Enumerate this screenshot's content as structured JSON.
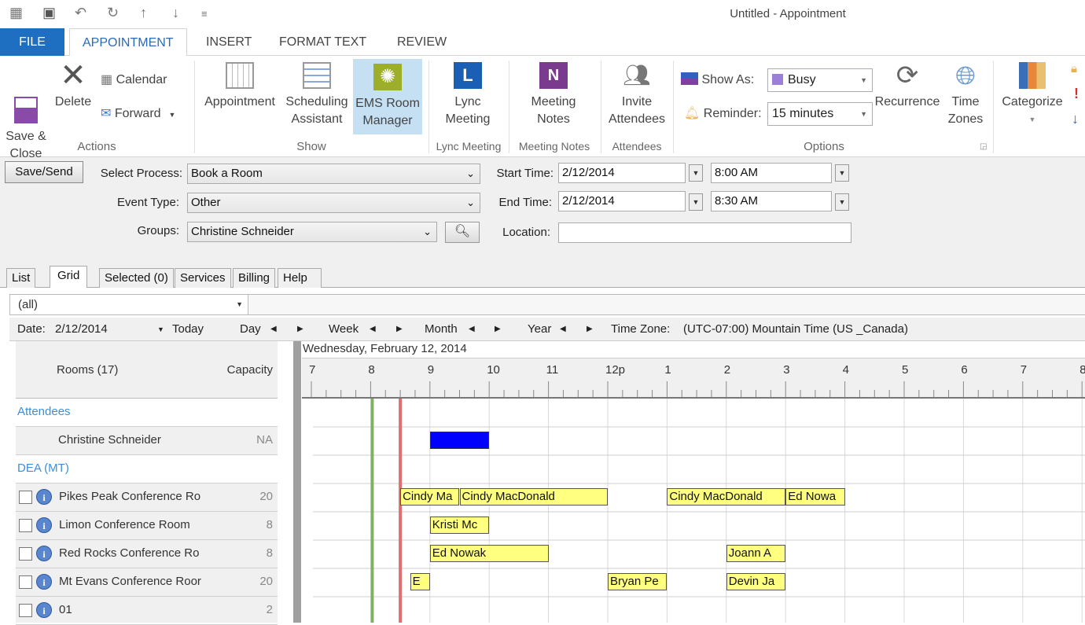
{
  "window": {
    "title": "Untitled - Appointment"
  },
  "ribbon_tabs": [
    "FILE",
    "APPOINTMENT",
    "INSERT",
    "FORMAT TEXT",
    "REVIEW"
  ],
  "ribbon": {
    "actions": {
      "save_close": "Save &\nClose",
      "delete": "Delete",
      "calendar": "Calendar",
      "forward": "Forward",
      "group": "Actions"
    },
    "show": {
      "appointment": "Appointment",
      "scheduling": "Scheduling\nAssistant",
      "ems": "EMS Room\nManager",
      "group": "Show"
    },
    "lync": {
      "label": "Lync\nMeeting",
      "group": "Lync Meeting"
    },
    "notes": {
      "label": "Meeting\nNotes",
      "group": "Meeting Notes"
    },
    "attendees": {
      "label": "Invite\nAttendees",
      "group": "Attendees"
    },
    "options": {
      "show_as_label": "Show As:",
      "show_as": "Busy",
      "reminder_label": "Reminder:",
      "reminder": "15 minutes",
      "recurrence": "Recurrence",
      "time_zones": "Time\nZones",
      "group": "Options"
    },
    "tags": {
      "categorize": "Categorize"
    }
  },
  "form": {
    "save_send": "Save/Send",
    "select_process_label": "Select Process:",
    "select_process": "Book a Room",
    "event_type_label": "Event Type:",
    "event_type": "Other",
    "groups_label": "Groups:",
    "groups": "Christine Schneider",
    "start_label": "Start Time:",
    "start_date": "2/12/2014",
    "start_time": "8:00 AM",
    "end_label": "End Time:",
    "end_date": "2/12/2014",
    "end_time": "8:30 AM",
    "location_label": "Location:",
    "location": ""
  },
  "tabs": [
    "List",
    "Grid",
    "Selected (0)",
    "Services",
    "Billing",
    "Help"
  ],
  "filter": "(all)",
  "nav": {
    "date_label": "Date:",
    "date": "2/12/2014",
    "today": "Today",
    "day": "Day",
    "week": "Week",
    "month": "Month",
    "year": "Year",
    "tz_label": "Time Zone:",
    "tz": "(UTC-07:00) Mountain Time (US _Canada)"
  },
  "grid": {
    "date_header": "Wednesday, February 12, 2014",
    "hours": [
      "7",
      "8",
      "9",
      "10",
      "11",
      "12p",
      "1",
      "2",
      "3",
      "4",
      "5",
      "6",
      "7",
      "8"
    ],
    "rooms_header": "Rooms (17)",
    "capacity_header": "Capacity",
    "rows": [
      {
        "type": "group",
        "name": "Attendees"
      },
      {
        "type": "person",
        "name": "Christine Schneider",
        "capacity": "NA"
      },
      {
        "type": "group",
        "name": "DEA (MT)"
      },
      {
        "type": "room",
        "name": "Pikes Peak Conference Ro",
        "capacity": "20"
      },
      {
        "type": "room",
        "name": "Limon Conference Room",
        "capacity": "8"
      },
      {
        "type": "room",
        "name": "Red Rocks Conference Ro",
        "capacity": "8"
      },
      {
        "type": "room",
        "name": "Mt Evans Conference Roor",
        "capacity": "20"
      },
      {
        "type": "room",
        "name": "01",
        "capacity": "2"
      }
    ],
    "selection": {
      "start": "8:00",
      "end": "8:30"
    },
    "bookings": [
      {
        "row": 1,
        "start": "9:00",
        "end": "10:00",
        "label": "",
        "color": "#0000ff"
      },
      {
        "row": 3,
        "start": "8:30",
        "end": "9:30",
        "label": "Cindy Ma"
      },
      {
        "row": 3,
        "start": "9:30",
        "end": "12:00",
        "label": "Cindy MacDonald"
      },
      {
        "row": 3,
        "start": "13:00",
        "end": "15:00",
        "label": "Cindy MacDonald"
      },
      {
        "row": 3,
        "start": "15:00",
        "end": "16:00",
        "label": "Ed Nowa"
      },
      {
        "row": 4,
        "start": "9:00",
        "end": "10:00",
        "label": "Kristi Mc"
      },
      {
        "row": 5,
        "start": "9:00",
        "end": "11:00",
        "label": "Ed Nowak"
      },
      {
        "row": 5,
        "start": "14:00",
        "end": "15:00",
        "label": "Joann A"
      },
      {
        "row": 6,
        "start": "8:40",
        "end": "9:00",
        "label": "E"
      },
      {
        "row": 6,
        "start": "12:00",
        "end": "13:00",
        "label": "Bryan Pe"
      },
      {
        "row": 6,
        "start": "14:00",
        "end": "15:00",
        "label": "Devin Ja"
      }
    ]
  },
  "colors": {
    "accent": "#1e6fc1",
    "booking": "#ffff80",
    "now": "#e07070",
    "start": "#80b060",
    "group": "#3b8fd8",
    "busy": "#9c7fd8"
  }
}
